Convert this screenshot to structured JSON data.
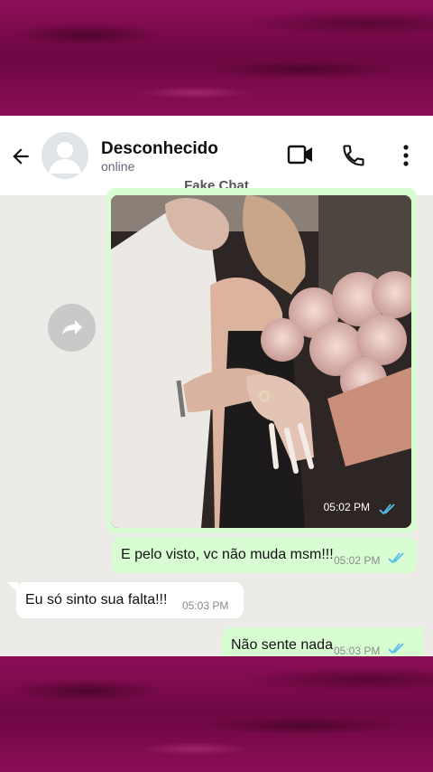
{
  "contact": {
    "name": "Desconhecido",
    "status": "online"
  },
  "watermark": "Fake Chat",
  "messages": [
    {
      "text": "",
      "time": "05:02 PM",
      "type": "image"
    },
    {
      "text": "E pelo visto, vc não muda msm!!!",
      "time": "05:02 PM",
      "type": "outgoing"
    },
    {
      "text": "Eu só sinto sua falta!!!",
      "time": "05:03 PM",
      "type": "incoming"
    },
    {
      "text": "Não sente nada",
      "time": "05:03 PM",
      "type": "outgoing"
    }
  ],
  "icons": [
    "back-arrow-icon",
    "avatar",
    "video-call-icon",
    "phone-icon",
    "more-options-icon",
    "forward-icon",
    "read-receipt-icon"
  ],
  "colors": {
    "outgoing_bubble": "#d9fdd3",
    "incoming_bubble": "#ffffff",
    "chat_bg": "#ecebe8",
    "read_check": "#53bdeb",
    "frame": "#7a0a4a"
  }
}
